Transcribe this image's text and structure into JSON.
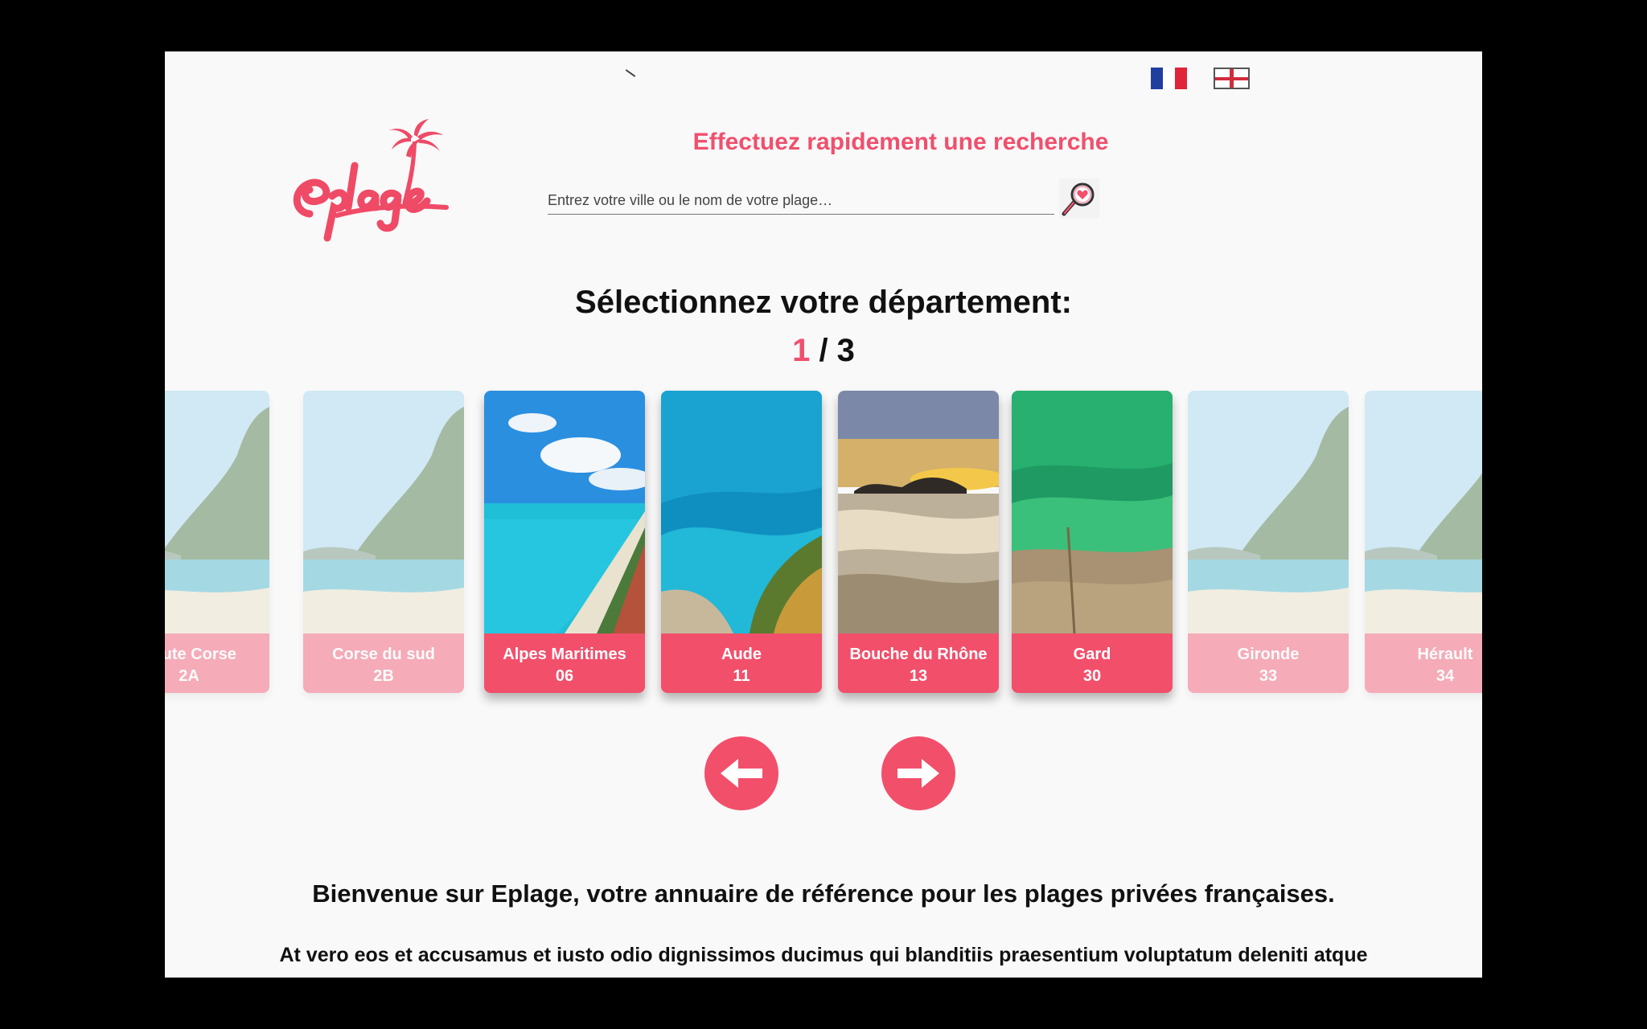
{
  "search": {
    "title": "Effectuez rapidement une recherche",
    "placeholder": "Entrez votre ville ou le nom de votre plage…"
  },
  "logo": {
    "text": "eplage"
  },
  "selection": {
    "title": "Sélectionnez votre département:",
    "page_current": "1",
    "page_separator": " / ",
    "page_total": "3"
  },
  "departments": [
    {
      "name": "Haute Corse",
      "code": "2A",
      "state": "faded",
      "image": "tropical-mountain-beach"
    },
    {
      "name": "Corse du sud",
      "code": "2B",
      "state": "faded",
      "image": "tropical-mountain-beach"
    },
    {
      "name": "Alpes Maritimes",
      "code": "06",
      "state": "active",
      "image": "aerial-coastline"
    },
    {
      "name": "Aude",
      "code": "11",
      "state": "active",
      "image": "turquoise-sea-cliff"
    },
    {
      "name": "Bouche du Rhône",
      "code": "13",
      "state": "active",
      "image": "sunset-rocks"
    },
    {
      "name": "Gard",
      "code": "30",
      "state": "active",
      "image": "green-water-beach"
    },
    {
      "name": "Gironde",
      "code": "33",
      "state": "faded",
      "image": "tropical-mountain-beach"
    },
    {
      "name": "Hérault",
      "code": "34",
      "state": "faded",
      "image": "tropical-mountain-beach"
    }
  ],
  "welcome": "Bienvenue sur Eplage, votre annuaire de référence pour les plages privées françaises.",
  "intro_text": "At vero eos et accusamus et iusto odio dignissimos ducimus qui blanditiis praesentium voluptatum deleniti atque corrupti quos dolores et quas molestias excepturi sint occaecati cupiditate",
  "colors": {
    "accent": "#f24f6b",
    "title_accent": "#f0506d",
    "text": "#111111",
    "background": "#f9f9f9"
  },
  "icons": {
    "search": "magnifier-heart-icon",
    "prev": "arrow-left-icon",
    "next": "arrow-right-icon",
    "lang_fr": "flag-fr-icon",
    "lang_en": "flag-en-icon"
  }
}
